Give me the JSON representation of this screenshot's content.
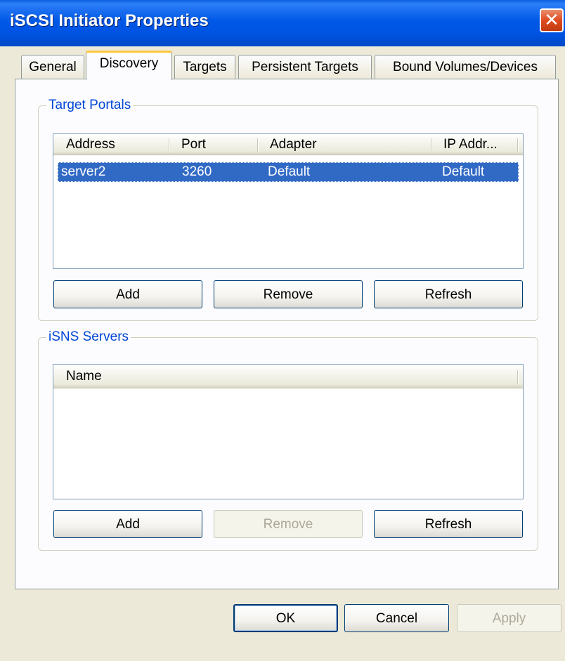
{
  "window": {
    "title": "iSCSI Initiator Properties",
    "close_glyph": "✕"
  },
  "tabs": [
    {
      "label": "General"
    },
    {
      "label": "Discovery",
      "active": true
    },
    {
      "label": "Targets"
    },
    {
      "label": "Persistent Targets"
    },
    {
      "label": "Bound Volumes/Devices"
    }
  ],
  "target_portals": {
    "legend": "Target Portals",
    "columns": [
      "Address",
      "Port",
      "Adapter",
      "IP Addr..."
    ],
    "rows": [
      {
        "address": "server2",
        "port": "3260",
        "adapter": "Default",
        "ip_address": "Default",
        "selected": true
      }
    ],
    "buttons": {
      "add": "Add",
      "remove": "Remove",
      "refresh": "Refresh"
    }
  },
  "isns_servers": {
    "legend": "iSNS Servers",
    "columns": [
      "Name"
    ],
    "rows": [],
    "buttons": {
      "add": "Add",
      "remove": "Remove",
      "refresh": "Refresh",
      "remove_disabled": true
    }
  },
  "footer": {
    "ok": "OK",
    "cancel": "Cancel",
    "apply": "Apply",
    "apply_disabled": true
  },
  "colors": {
    "title_bar": "#0054e3",
    "selection": "#316ac5",
    "group_legend": "#0046d5",
    "active_tab_accent": "#ffc83c"
  }
}
